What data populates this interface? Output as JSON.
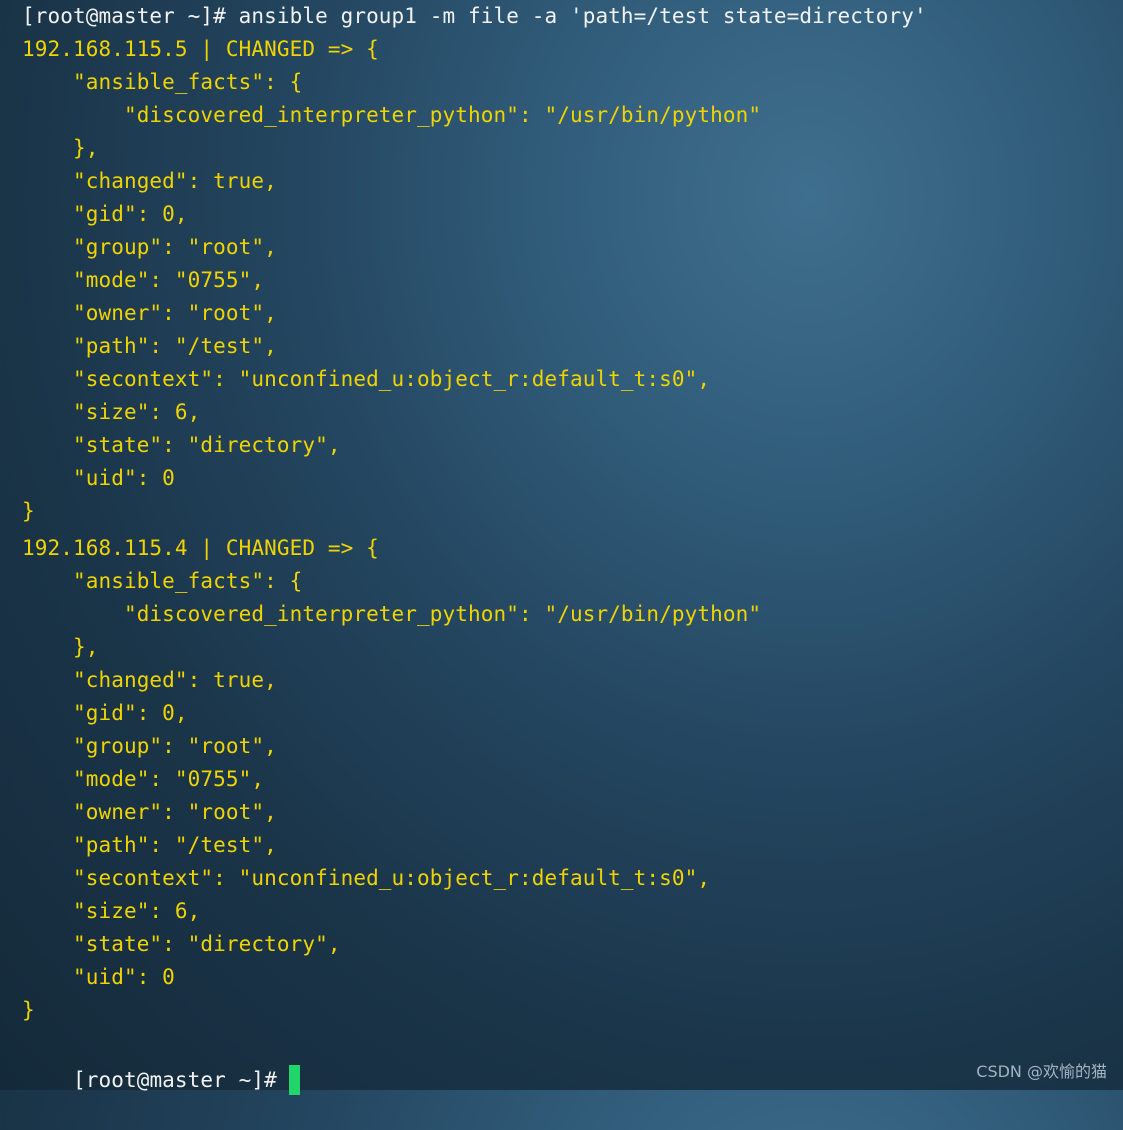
{
  "terminal": {
    "command_line": "[root@master ~]# ansible group1 -m file -a 'path=/test state=directory'",
    "results": [
      {
        "header": "192.168.115.5 | CHANGED => {",
        "lines": [
          "    \"ansible_facts\": {",
          "        \"discovered_interpreter_python\": \"/usr/bin/python\"",
          "    },",
          "    \"changed\": true,",
          "    \"gid\": 0,",
          "    \"group\": \"root\",",
          "    \"mode\": \"0755\",",
          "    \"owner\": \"root\",",
          "    \"path\": \"/test\",",
          "    \"secontext\": \"unconfined_u:object_r:default_t:s0\",",
          "    \"size\": 6,",
          "    \"state\": \"directory\",",
          "    \"uid\": 0"
        ],
        "closing": "}"
      },
      {
        "header": "192.168.115.4 | CHANGED => {",
        "lines": [
          "    \"ansible_facts\": {",
          "        \"discovered_interpreter_python\": \"/usr/bin/python\"",
          "    },",
          "    \"changed\": true,",
          "    \"gid\": 0,",
          "    \"group\": \"root\",",
          "    \"mode\": \"0755\",",
          "    \"owner\": \"root\",",
          "    \"path\": \"/test\",",
          "    \"secontext\": \"unconfined_u:object_r:default_t:s0\",",
          "    \"size\": 6,",
          "    \"state\": \"directory\",",
          "    \"uid\": 0"
        ],
        "closing": "}"
      }
    ],
    "prompt": "[root@master ~]#"
  },
  "watermark": "CSDN @欢愉的猫",
  "colors": {
    "command_text": "#f2f2f2",
    "output_text": "#f0d400",
    "cursor": "#20d66b",
    "background": "#244660"
  }
}
